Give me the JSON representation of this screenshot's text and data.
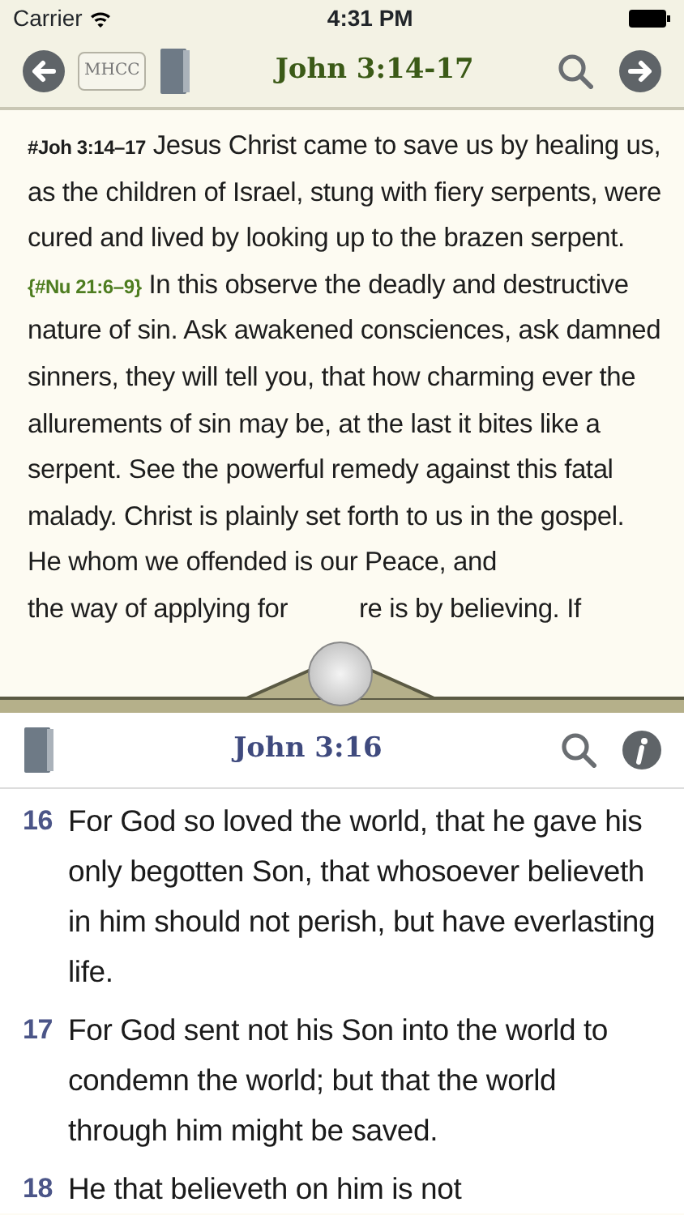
{
  "status_bar": {
    "carrier": "Carrier",
    "time": "4:31 PM"
  },
  "top_toolbar": {
    "commentary_button": "MHCC",
    "title": "John 3:14-17"
  },
  "commentary": {
    "segments": [
      {
        "kind": "ref",
        "text": "#Joh 3:14–17"
      },
      {
        "kind": "text",
        "text": " Jesus Christ came to save us by healing us, as the children of Israel, stung with fiery serpents, were cured and lived by looking up to the brazen serpent. "
      },
      {
        "kind": "link",
        "text": "{#Nu 21:6–9}"
      },
      {
        "kind": "text",
        "text": " In this observe the deadly and destructive nature of sin. Ask awakened consciences, ask damned sinners, they will tell you, that how charming ever the allurements of sin may be, at the last it bites like a serpent. See the powerful remedy against this fatal malady. Christ is plainly set forth to us in the gospel. He whom we offended is our Peace, and"
      }
    ],
    "covered_line": [
      "the way of applying for",
      "re is by believing. If"
    ]
  },
  "bottom_toolbar": {
    "title": "John 3:16"
  },
  "verses": [
    {
      "number": "16",
      "text": "For God so loved the world, that he gave his only begotten Son, that whosoever believeth in him should not perish, but have everlasting life."
    },
    {
      "number": "17",
      "text": "For God sent not his Son into the world to condemn the world; but that the world through him might be saved."
    },
    {
      "number": "18",
      "text": "He that believeth on him is not"
    }
  ]
}
